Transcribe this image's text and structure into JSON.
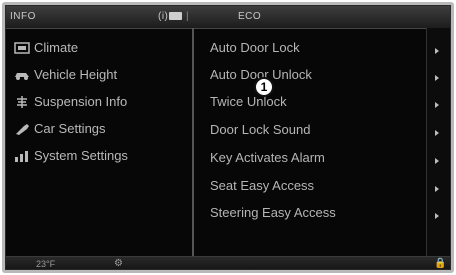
{
  "header": {
    "title": "INFO",
    "info_icon_text": "(i)",
    "separator": "|",
    "status_text": "ECO"
  },
  "sidebar": {
    "items": [
      {
        "label": "Climate",
        "icon": "climate-icon"
      },
      {
        "label": "Vehicle Height",
        "icon": "vehicle-height-icon"
      },
      {
        "label": "Suspension Info",
        "icon": "suspension-icon"
      },
      {
        "label": "Car Settings",
        "icon": "car-settings-icon"
      },
      {
        "label": "System Settings",
        "icon": "system-settings-icon"
      }
    ]
  },
  "menu": {
    "items": [
      {
        "label": "Auto Door Lock"
      },
      {
        "label": "Auto Door Unlock"
      },
      {
        "label": "Twice Unlock"
      },
      {
        "label": "Door Lock Sound"
      },
      {
        "label": "Key Activates Alarm"
      },
      {
        "label": "Seat Easy Access"
      },
      {
        "label": "Steering Easy Access"
      }
    ]
  },
  "callout": {
    "number": "1"
  },
  "footer": {
    "temperature": "23°F",
    "gear_icon_text": "⚙",
    "lock_icon_text": "🔒"
  },
  "colors": {
    "background": "#070707",
    "text": "#b9b9b9",
    "bezel": "#b9b9b9"
  }
}
